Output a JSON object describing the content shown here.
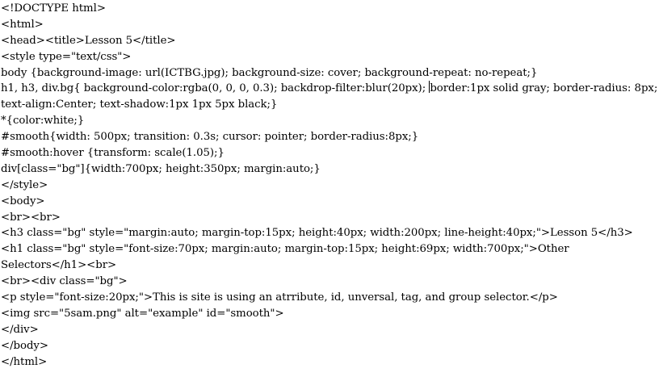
{
  "editor": {
    "lines": [
      "<!DOCTYPE html>",
      "<html>",
      "<head><title>Lesson 5</title>",
      "<style type=\"text/css\">",
      "body {background-image: url(ICTBG.jpg); background-size: cover; background-repeat: no-repeat;}",
      "h1, h3, div.bg{ background-color:rgba(0, 0, 0, 0.3); backdrop-filter:blur(20px); ",
      "text-align:Center; text-shadow:1px 1px 5px black;}",
      "*{color:white;}",
      "#smooth{width: 500px; transition: 0.3s; cursor: pointer; border-radius:8px;}",
      "#smooth:hover {transform: scale(1.05);}",
      "div[class=\"bg\"]{width:700px; height:350px; margin:auto;}",
      "</style>",
      "<body>",
      "<br><br>",
      "<h3 class=\"bg\" style=\"margin:auto; margin-top:15px; height:40px; width:200px; line-height:40px;\">Lesson 5</h3>",
      "<h1 class=\"bg\" style=\"font-size:70px; margin:auto; margin-top:15px; height:69px; width:700px;\">Other",
      "Selectors</h1><br>",
      "<br><div class=\"bg\">",
      "<p style=\"font-size:20px;\">This is site is using an atrribute, id, unversal, tag, and group selector.</p>",
      "<img src=\"5sam.png\" alt=\"example\" id=\"smooth\">",
      "</div>",
      "</body>",
      "</html>"
    ],
    "cursor_line_rest": "border:1px solid gray; border-radius: 8px;"
  }
}
